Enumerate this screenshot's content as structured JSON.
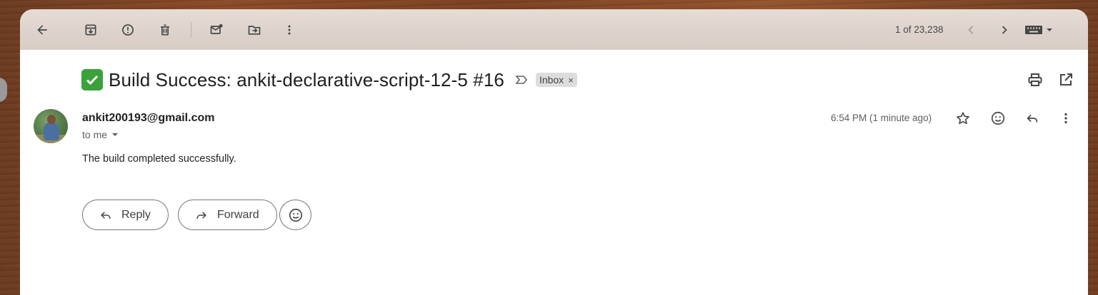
{
  "toolbar": {
    "icons": [
      "back-arrow-icon",
      "archive-icon",
      "report-spam-icon",
      "delete-icon",
      "mark-unread-icon",
      "move-to-icon",
      "more-vert-icon"
    ],
    "pager_text": "1 of 23,238",
    "nav_icons": [
      "chevron-left-icon",
      "chevron-right-icon"
    ],
    "input_tools_icon": "keyboard-icon"
  },
  "subject": {
    "emoji": "✅",
    "title": "Build Success: ankit-declarative-script-12-5 #16",
    "label": "Inbox",
    "label_remove": "×"
  },
  "header_actions": [
    "print-icon",
    "open-new-window-icon"
  ],
  "message": {
    "sender": "ankit200193@gmail.com",
    "recipient": "to me",
    "time": "6:54 PM (1 minute ago)",
    "body": "The build completed successfully.",
    "actions": [
      "star-icon",
      "emoji-react-icon",
      "reply-icon",
      "more-vert-icon"
    ]
  },
  "reply_actions": {
    "reply_label": "Reply",
    "forward_label": "Forward"
  },
  "colors": {
    "toolbar_bg": "#ddd2cb",
    "card_bg": "#ffffff",
    "chip_bg": "#dddddd",
    "check_green": "#3ba13b",
    "text_primary": "#1f1f1f"
  }
}
